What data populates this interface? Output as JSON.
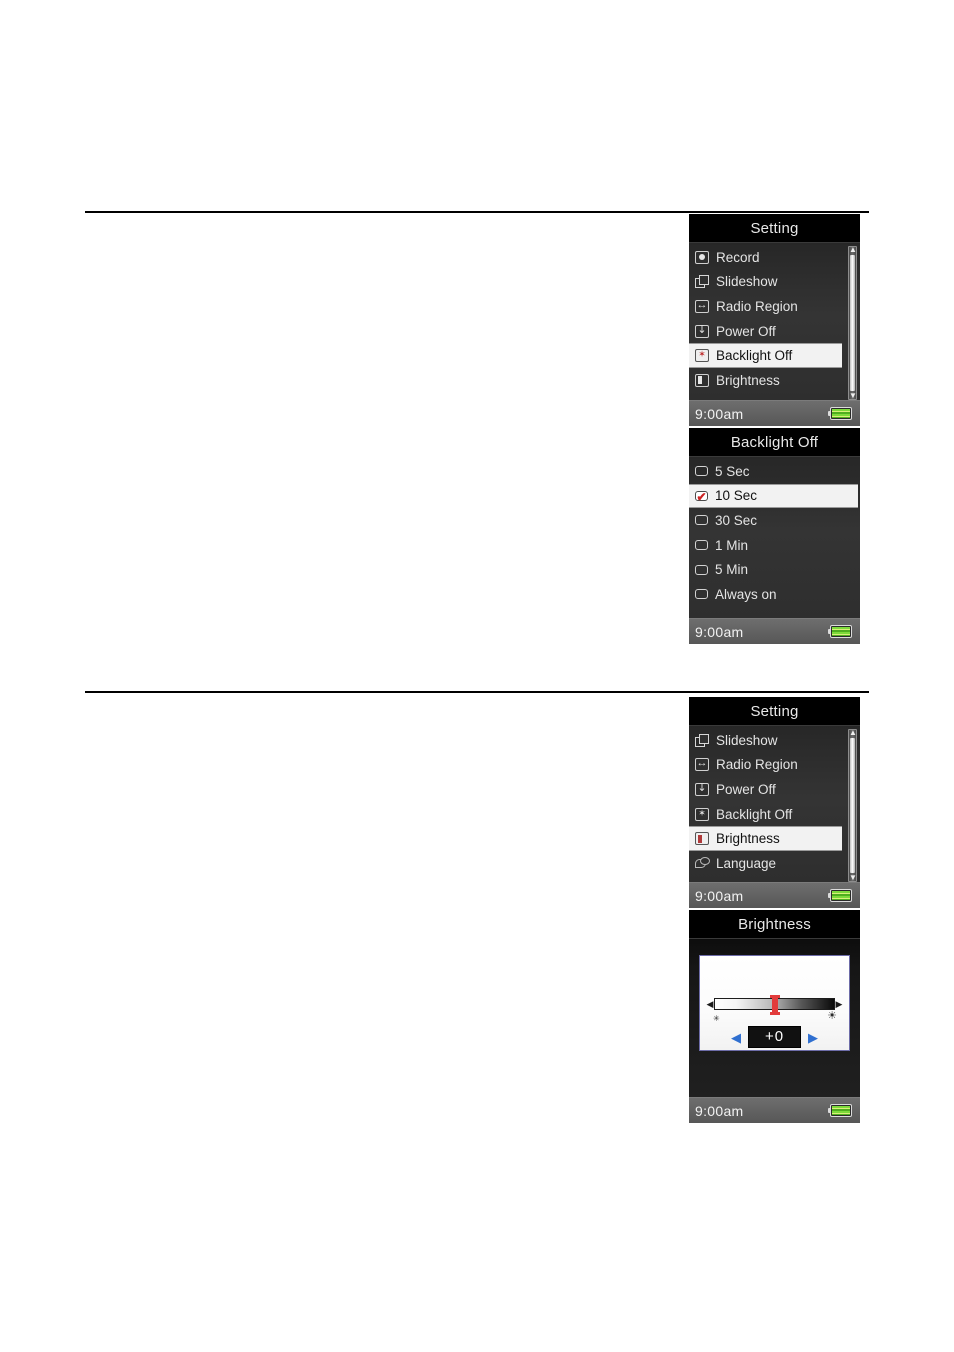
{
  "page": {
    "background": "#ffffff",
    "rule_color": "#000000"
  },
  "screens": {
    "setting_1": {
      "title": "Setting",
      "items": [
        {
          "label": "Record",
          "icon": "record-icon",
          "selected": false
        },
        {
          "label": "Slideshow",
          "icon": "slideshow-icon",
          "selected": false
        },
        {
          "label": "Radio Region",
          "icon": "radio-region-icon",
          "selected": false
        },
        {
          "label": "Power Off",
          "icon": "power-off-icon",
          "selected": false
        },
        {
          "label": "Backlight Off",
          "icon": "backlight-off-icon",
          "selected": true
        },
        {
          "label": "Brightness",
          "icon": "brightness-icon",
          "selected": false
        }
      ],
      "scrollbar": {
        "up_arrow": "▲",
        "down_arrow": "▼",
        "thumb_top_pct": 4,
        "thumb_height_pct": 88
      },
      "status": {
        "clock": "9:00am",
        "battery": "battery-icon"
      }
    },
    "backlight_off": {
      "title": "Backlight Off",
      "items": [
        {
          "label": "5 Sec",
          "checked": false,
          "selected": false
        },
        {
          "label": "10 Sec",
          "checked": true,
          "selected": true
        },
        {
          "label": "30 Sec",
          "checked": false,
          "selected": false
        },
        {
          "label": "1 Min",
          "checked": false,
          "selected": false
        },
        {
          "label": "5 Min",
          "checked": false,
          "selected": false
        },
        {
          "label": "Always on",
          "checked": false,
          "selected": false
        }
      ],
      "status": {
        "clock": "9:00am",
        "battery": "battery-icon"
      }
    },
    "setting_2": {
      "title": "Setting",
      "items": [
        {
          "label": "Slideshow",
          "icon": "slideshow-icon",
          "selected": false
        },
        {
          "label": "Radio Region",
          "icon": "radio-region-icon",
          "selected": false
        },
        {
          "label": "Power Off",
          "icon": "power-off-icon",
          "selected": false
        },
        {
          "label": "Backlight Off",
          "icon": "backlight-off-icon",
          "selected": false
        },
        {
          "label": "Brightness",
          "icon": "brightness-icon",
          "selected": true
        },
        {
          "label": "Language",
          "icon": "language-icon",
          "selected": false
        }
      ],
      "scrollbar": {
        "up_arrow": "▲",
        "down_arrow": "▼",
        "thumb_top_pct": 6,
        "thumb_height_pct": 86
      },
      "status": {
        "clock": "9:00am",
        "battery": "battery-icon"
      }
    },
    "brightness": {
      "title": "Brightness",
      "slider": {
        "left_arrow": "◀",
        "right_arrow": "▶",
        "low_icon": "dim-sun-icon",
        "high_icon": "bright-sun-icon",
        "low_glyph": "✳",
        "high_glyph": "☀",
        "position_pct": 50,
        "handle_color": "#e23b3b"
      },
      "value": {
        "text": "+0",
        "dec_arrow": "◀",
        "inc_arrow": "▶",
        "arrow_color": "#2f6fd0"
      },
      "status": {
        "clock": "9:00am",
        "battery": "battery-icon"
      }
    }
  }
}
